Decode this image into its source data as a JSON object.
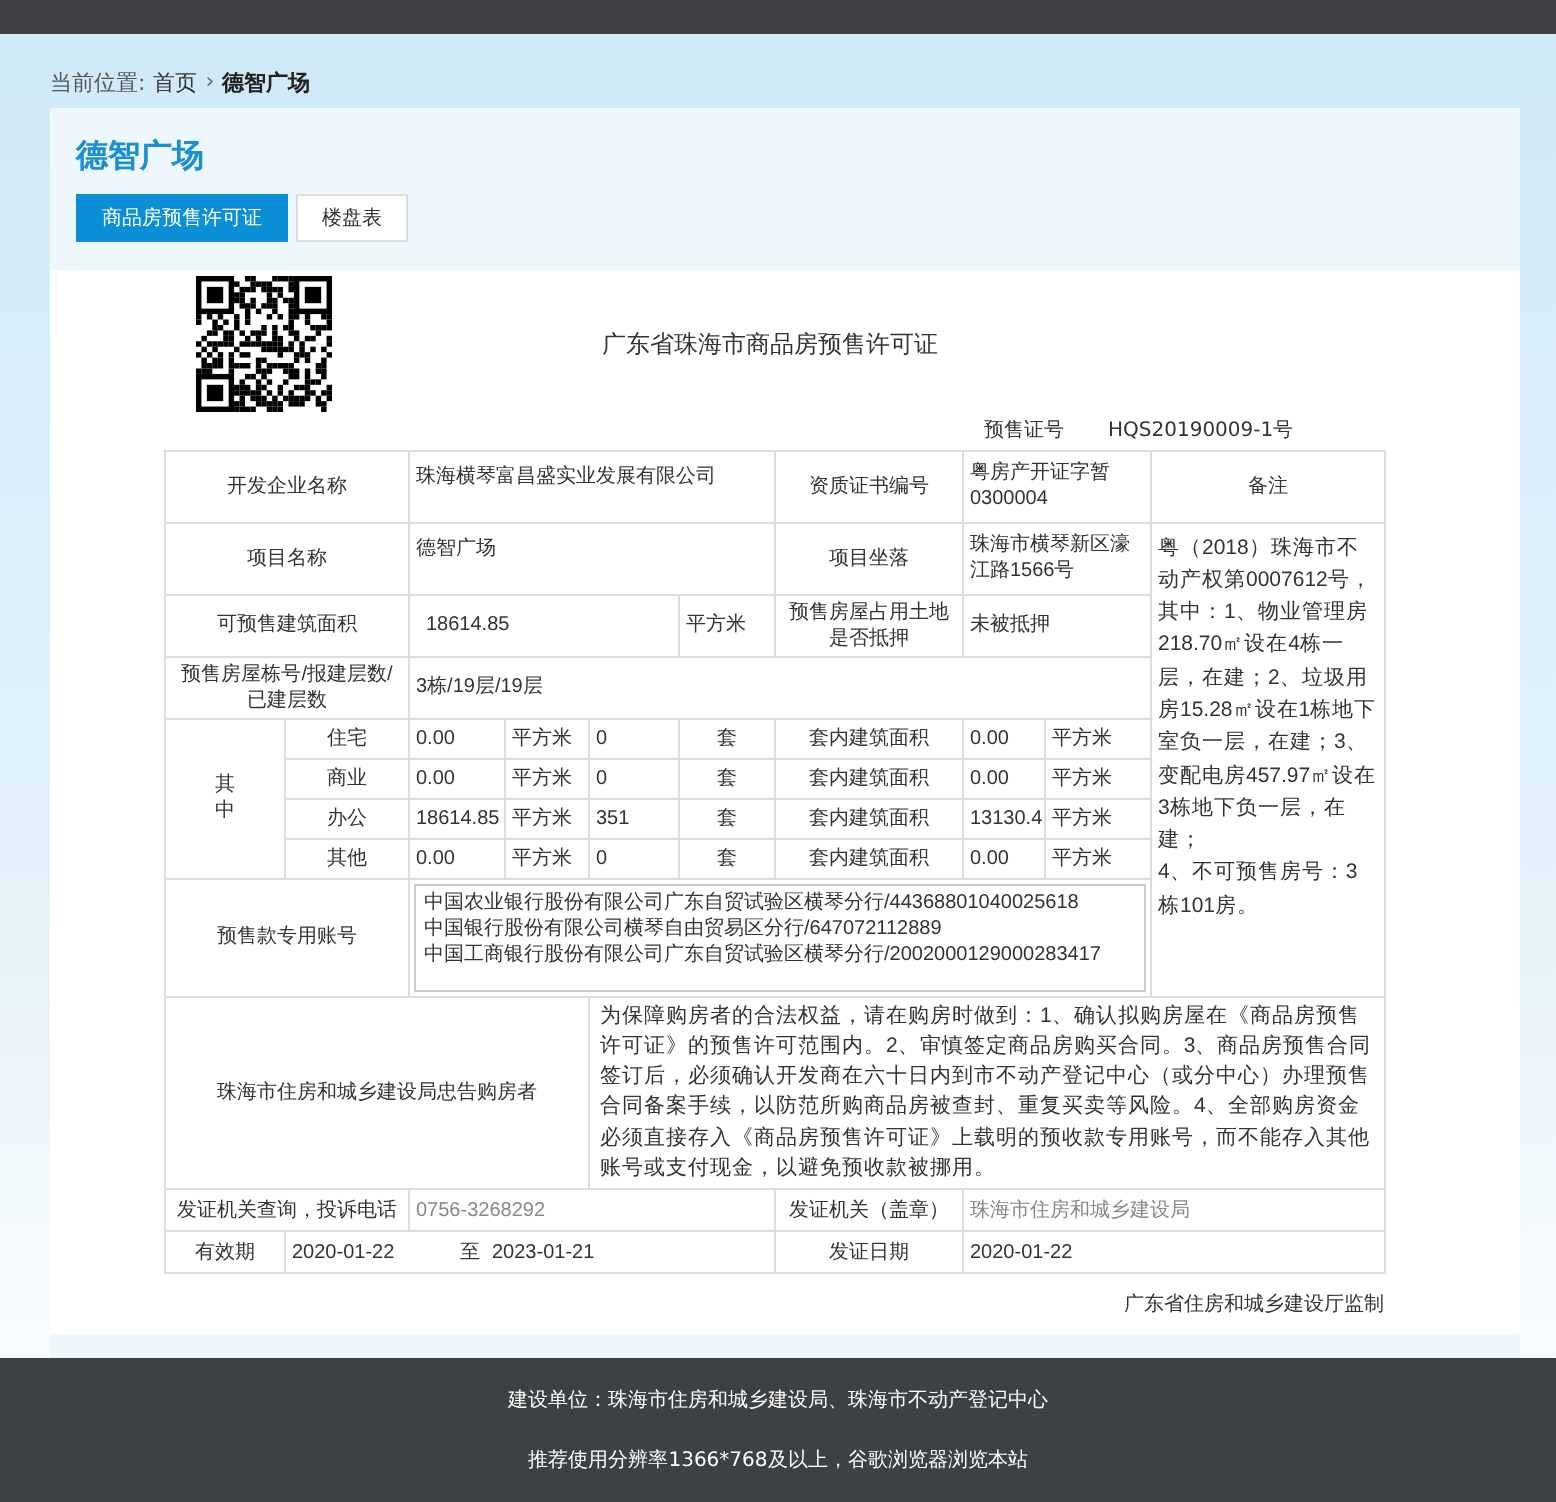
{
  "breadcrumb": {
    "label": "当前位置:",
    "separator": "›",
    "items": [
      {
        "text": "首页"
      },
      {
        "text": "德智广场"
      }
    ]
  },
  "title": "德智广场",
  "tabs": [
    {
      "label": "商品房预售许可证",
      "selected": true
    },
    {
      "label": "楼盘表",
      "selected": false
    }
  ],
  "certificate": {
    "title": "广东省珠海市商品房预售许可证",
    "permit_label": "预售证号",
    "permit_no": "HQS20190009-1号",
    "developer_label": "开发企业名称",
    "developer": "珠海横琴富昌盛实业发展有限公司",
    "qualification_label": "资质证书编号",
    "qualification": "粤房产开证字暂0300004",
    "remarks_label": "备注",
    "project_label": "项目名称",
    "project": "德智广场",
    "location_label": "项目坐落",
    "location": "珠海市横琴新区濠江路1566号",
    "remarks": "粤（2018）珠海市不动产权第0007612号，其中：1、物业管理房218.70㎡设在4栋一层，在建；2、垃圾用房15.28㎡设在1栋地下室负一层，在建；3、变配电房457.97㎡设在3栋地下负一层，在建；\n4、不可预售房号：3栋101房。",
    "area_label": "可预售建筑面积",
    "area": "18614.85",
    "area_unit": "平方米",
    "mortgage_label": "预售房屋占用土地是否抵押",
    "mortgage": "未被抵押",
    "floors_label": "预售房屋栋号/报建层数/已建层数",
    "floors": "3栋/19层/19层",
    "breakdown_label": "其中",
    "breakdown": [
      {
        "use": "住宅",
        "area": "0.00",
        "area_unit": "平方米",
        "count": "0",
        "count_unit": "套",
        "inner_label": "套内建筑面积",
        "inner_area": "0.00",
        "inner_unit": "平方米"
      },
      {
        "use": "商业",
        "area": "0.00",
        "area_unit": "平方米",
        "count": "0",
        "count_unit": "套",
        "inner_label": "套内建筑面积",
        "inner_area": "0.00",
        "inner_unit": "平方米"
      },
      {
        "use": "办公",
        "area": "18614.85",
        "area_unit": "平方米",
        "count": "351",
        "count_unit": "套",
        "inner_label": "套内建筑面积",
        "inner_area": "13130.4",
        "inner_unit": "平方米"
      },
      {
        "use": "其他",
        "area": "0.00",
        "area_unit": "平方米",
        "count": "0",
        "count_unit": "套",
        "inner_label": "套内建筑面积",
        "inner_area": "0.00",
        "inner_unit": "平方米"
      }
    ],
    "accounts_label": "预售款专用账号",
    "accounts": [
      "中国农业银行股份有限公司广东自贸试验区横琴分行/44368801040025618",
      "中国银行股份有限公司横琴自由贸易区分行/647072112889",
      "中国工商银行股份有限公司广东自贸试验区横琴分行/2002000129000283417"
    ],
    "advice_label": "珠海市住房和城乡建设局忠告购房者",
    "advice": "为保障购房者的合法权益，请在购房时做到：1、确认拟购房屋在《商品房预售许可证》的预售许可范围内。2、审慎签定商品房购买合同。3、商品房预售合同签订后，必须确认开发商在六十日内到市不动产登记中心（或分中心）办理预售合同备案手续，以防范所购商品房被查封、重复买卖等风险。4、全部购房资金必须直接存入《商品房预售许可证》上载明的预收款专用账号，而不能存入其他账号或支付现金，以避免预收款被挪用。",
    "phone_label": "发证机关查询，投诉电话",
    "phone": "0756-3268292",
    "authority_label": "发证机关（盖章）",
    "authority": "珠海市住房和城乡建设局",
    "valid_label": "有效期",
    "valid_from": "2020-01-22",
    "valid_to_label": "至",
    "valid_to": "2023-01-21",
    "issue_label": "发证日期",
    "issue_date": "2020-01-22",
    "supervisor": "广东省住房和城乡建设厅监制"
  },
  "footer": [
    "建设单位：珠海市住房和城乡建设局、珠海市不动产登记中心",
    "推荐使用分辨率1366*768及以上，谷歌浏览器浏览本站"
  ]
}
